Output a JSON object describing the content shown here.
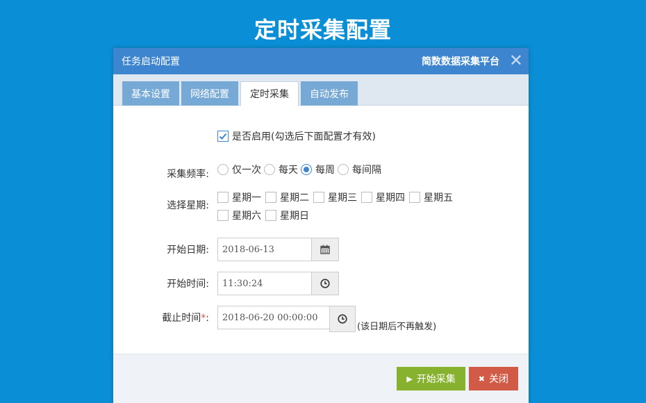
{
  "page_title": "定时采集配置",
  "dialog": {
    "title": "任务启动配置",
    "brand": "简数数据采集平台",
    "close_glyph": "✕"
  },
  "tabs": [
    {
      "label": "基本设置",
      "active": false
    },
    {
      "label": "网络配置",
      "active": false
    },
    {
      "label": "定时采集",
      "active": true
    },
    {
      "label": "自动发布",
      "active": false
    }
  ],
  "enable": {
    "label": "是否启用(勾选后下面配置才有效)",
    "checked": true
  },
  "frequency": {
    "label": "采集频率:",
    "options": [
      "仅一次",
      "每天",
      "每周",
      "每间隔"
    ],
    "selected": "每周"
  },
  "weekday": {
    "label": "选择星期:",
    "options": [
      "星期一",
      "星期二",
      "星期三",
      "星期四",
      "星期五",
      "星期六",
      "星期日"
    ]
  },
  "start_date": {
    "label": "开始日期:",
    "value": "2018-06-13",
    "icon": "calendar-icon"
  },
  "start_time": {
    "label": "开始时间:",
    "value": "11:30:24",
    "icon": "clock-icon"
  },
  "end_time": {
    "label": "截止时间",
    "required_mark": "*",
    "colon": ":",
    "value": "2018-06-20 00:00:00",
    "icon": "clock-icon",
    "hint": "(该日期后不再触发)"
  },
  "buttons": {
    "start": "开始采集",
    "close": "关闭"
  },
  "colors": {
    "background": "#0a8fd6",
    "header": "#3d86cf",
    "tab": "#76a9d5",
    "start_button": "#87b22f",
    "close_button": "#d15b47"
  }
}
